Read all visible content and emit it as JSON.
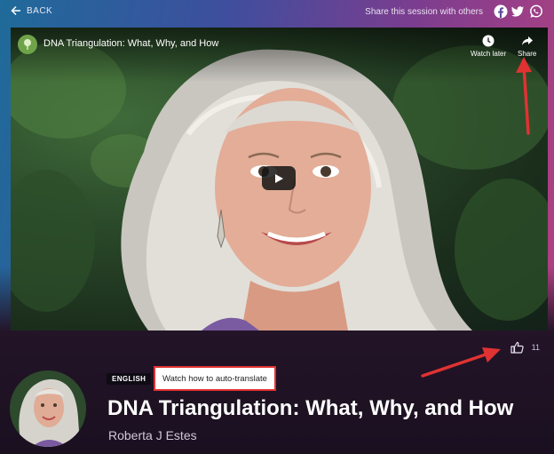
{
  "topbar": {
    "back_label": "BACK",
    "share_text": "Share this session with others",
    "social_icons": [
      "facebook-icon",
      "twitter-icon",
      "whatsapp-icon"
    ]
  },
  "video": {
    "title": "DNA Triangulation: What, Why, and How",
    "watch_later_label": "Watch later",
    "share_label": "Share"
  },
  "likes": {
    "count": "11"
  },
  "session": {
    "language_badge": "ENGLISH",
    "translate_link": "Watch how to auto-translate",
    "title": "DNA Triangulation: What, Why, and How",
    "speaker": "Roberta J Estes"
  },
  "colors": {
    "annotation_red": "#e03232",
    "page_bg_start": "#1f6b9a",
    "page_bg_end": "#b8417f"
  }
}
